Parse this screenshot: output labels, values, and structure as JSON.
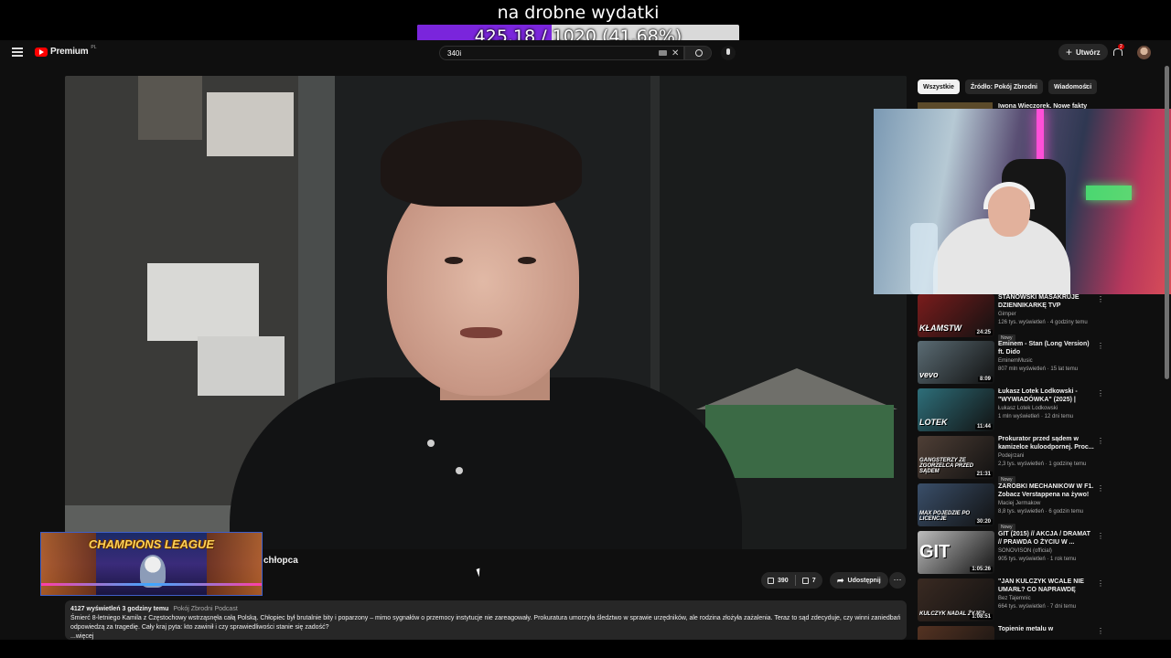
{
  "goal": {
    "title": "na drobne wydatki",
    "progress_text": "425.18 / 1020 (41.68%)",
    "progress_fraction": 0.4168,
    "fill_color": "#7a25dc"
  },
  "header": {
    "logo_text": "Premium",
    "logo_region": "PL",
    "search_value": "340i",
    "create_label": "Utwórz",
    "notifications_count": "2",
    "icons": [
      "menu-icon",
      "youtube-logo",
      "keyboard-icon",
      "clear-icon",
      "search-icon",
      "mic-icon",
      "plus-icon",
      "bell-icon",
      "avatar"
    ]
  },
  "video": {
    "title": "chłopca",
    "likes": "390",
    "dislikes": "7",
    "share_label": "Udostępnij",
    "more_label": "⋯"
  },
  "overlay": {
    "champions_title": "CHAMPIONS LEAGUE"
  },
  "description": {
    "views": "4127 wyświetleń",
    "time": "3 godziny temu",
    "channel_tag": "Pokój Zbrodni Podcast",
    "text": "Śmierć 8-letniego Kamila z Częstochowy wstrząsnęła całą Polską. Chłopiec był brutalnie bity i poparzony – mimo sygnałów o przemocy instytucje nie zareagowały. Prokuratura umorzyła śledztwo w sprawie urzędników, ale rodzina złożyła zażalenia. Teraz to sąd zdecyduje, czy winni zaniedbań odpowiedzą za tragedię. Cały kraj pyta: kto zawinił i czy sprawiedliwości stanie się zadość?",
    "more": "...więcej"
  },
  "sidebar": {
    "chips": [
      "Wszystkie",
      "Źródło: Pokój Zbrodni",
      "Wiadomości"
    ],
    "peek_title": "Iwona Wieczorek. Nowe fakty",
    "recommendations": [
      {
        "title": "STANOWSKI MASAKRUJE DZIENNIKARKĘ TVP",
        "channel": "Gimper",
        "meta": "126 tys. wyświetleń · 4 godziny temu",
        "badge": "Nowy",
        "duration": "24:25",
        "thumb_text": "KŁAMSTW",
        "thumb_color": "#7a1c1c"
      },
      {
        "title": "Eminem - Stan (Long Version) ft. Dido",
        "channel": "EminemMusic",
        "meta": "807 mln wyświetleń · 15 lat temu",
        "badge": "",
        "duration": "8:09",
        "thumb_text": "vevo",
        "thumb_color": "#5b6c74"
      },
      {
        "title": "Łukasz Lotek Lodkowski - \"WYWIADÓWKA\" (2025) | Stan...",
        "channel": "Łukasz Lotek Lodkowski",
        "meta": "1 mln wyświetleń · 12 dni temu",
        "badge": "",
        "duration": "11:44",
        "thumb_text": "LOTEK",
        "thumb_color": "#2e6f7a"
      },
      {
        "title": "Prokurator przed sądem w kamizelce kuloodpornej. Proc...",
        "channel": "Podejrzani",
        "meta": "2,3 tys. wyświetleń · 1 godzinę temu",
        "badge": "Nowy",
        "duration": "21:31",
        "thumb_text": "GANGSTERZY ZE ZGORZELCA PRZED SĄDEM",
        "thumb_color": "#4f3f36"
      },
      {
        "title": "ZAROBKI MECHANIKÓW W F1. Zobacz Verstappena na żywo! ...",
        "channel": "Maciej Jermakow",
        "meta": "8,8 tys. wyświetleń · 6 godzin temu",
        "badge": "Nowy",
        "duration": "30:20",
        "thumb_text": "MAX POJEDZIE PO LICENCJE",
        "thumb_color": "#3a4f6a"
      },
      {
        "title": "GIT (2015) // AKCJA / DRAMAT // PRAWDA O ŻYCIU W ...",
        "channel": "SONOVISON (official)",
        "meta": "905 tys. wyświetleń · 1 rok temu",
        "badge": "",
        "duration": "1:05:26",
        "thumb_text": "GIT",
        "thumb_color": "#bdbdbd"
      },
      {
        "title": "\"JAN KULCZYK WCALE NIE UMARŁ? CO NAPRAWDĘ STAŁ...",
        "channel": "Bez Tajemnic",
        "meta": "664 tys. wyświetleń · 7 dni temu",
        "badge": "",
        "duration": "1:08:51",
        "thumb_text": "KULCZYK NADAL ŻYJE?",
        "thumb_color": "#3a2a22"
      },
      {
        "title": "Topienie metalu w",
        "channel": "",
        "meta": "",
        "badge": "",
        "duration": "",
        "thumb_text": "",
        "thumb_color": "#553322"
      }
    ]
  }
}
